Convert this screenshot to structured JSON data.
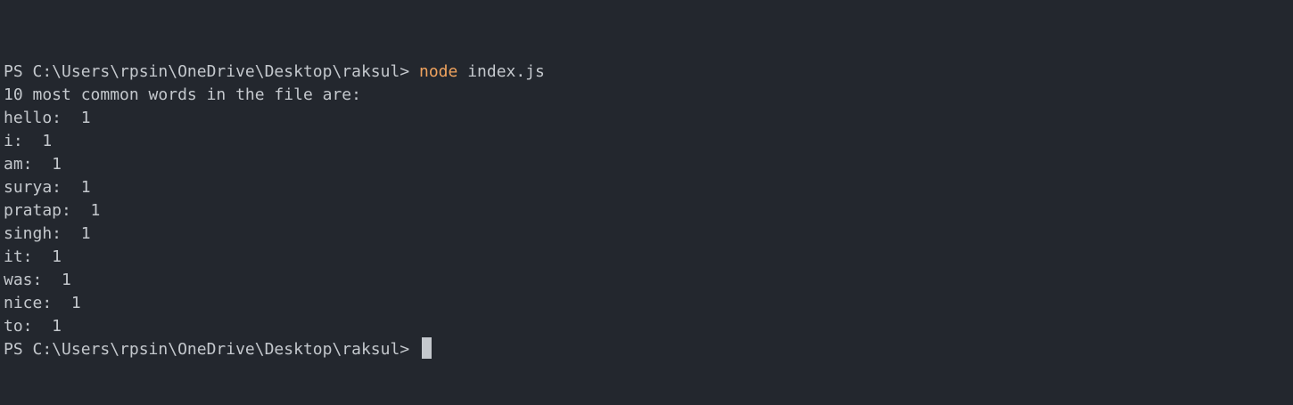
{
  "terminal": {
    "prompt": "PS C:\\Users\\rpsin\\OneDrive\\Desktop\\raksul> ",
    "command": "node",
    "argument": " index.js",
    "heading": "10 most common words in the file are:",
    "results": [
      "hello:  1",
      "i:  1",
      "am:  1",
      "surya:  1",
      "pratap:  1",
      "singh:  1",
      "it:  1",
      "was:  1",
      "nice:  1",
      "to:  1"
    ],
    "final_prompt": "PS C:\\Users\\rpsin\\OneDrive\\Desktop\\raksul> "
  }
}
